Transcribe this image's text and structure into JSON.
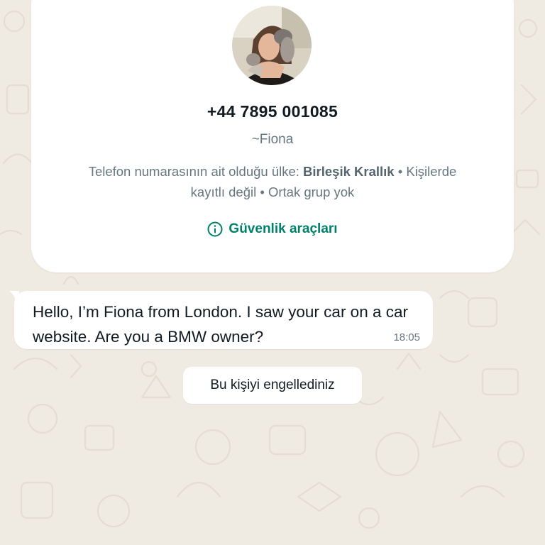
{
  "contact": {
    "phone_number": "+44 7895 001085",
    "push_name": "~Fiona",
    "country_prefix": "Telefon numarasının ait olduğu ülke: ",
    "country": "Birleşik Krallık",
    "not_saved_first": " • Kişilerde",
    "not_saved_second": "kayıtlı değil",
    "no_common_groups": " • Ortak grup yok",
    "safety_tools_label": "Güvenlik araçları",
    "safety_icon": "info-circle-icon"
  },
  "message": {
    "text": "Hello, I’m Fiona from London. I saw your car on a car website. Are you a BMW owner?",
    "time": "18:05"
  },
  "system": {
    "blocked_notice": "Bu kişiyi engellediniz"
  },
  "colors": {
    "wallpaper": "#efeae2",
    "accent": "#008069",
    "bubble": "#ffffff",
    "muted_text": "#667781"
  }
}
